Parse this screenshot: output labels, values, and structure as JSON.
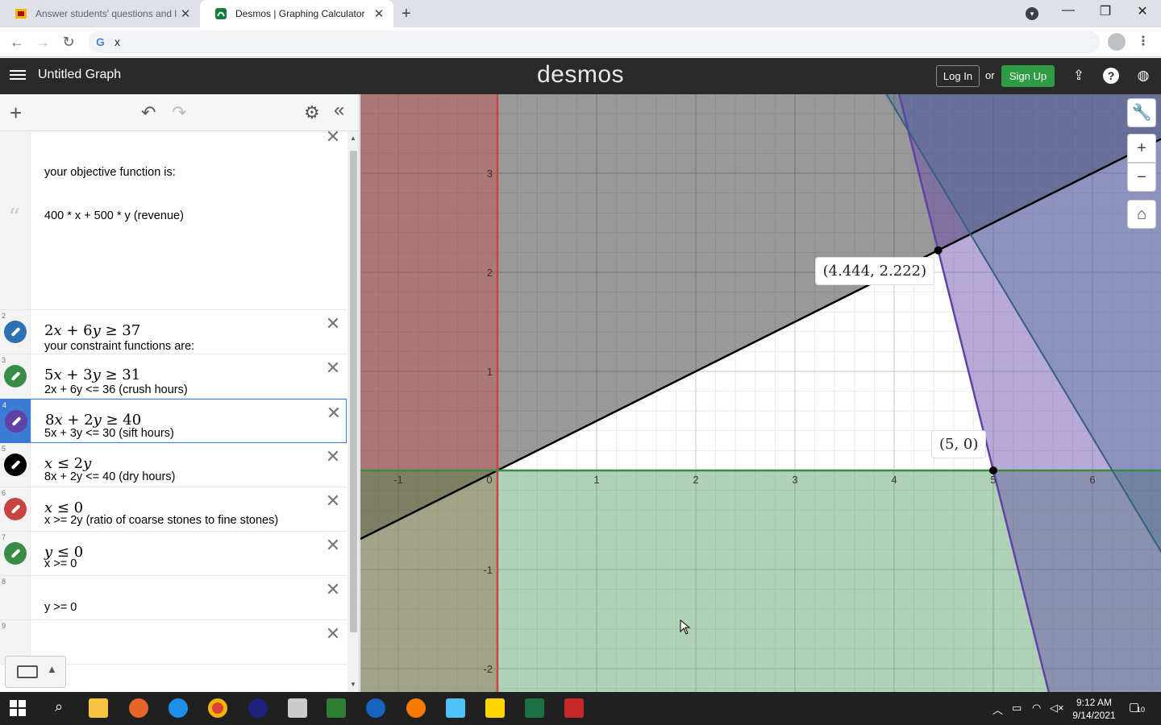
{
  "browser": {
    "tabs": [
      {
        "title": "Answer students' questions and l",
        "active": false
      },
      {
        "title": "Desmos | Graphing Calculator",
        "active": true
      }
    ],
    "address": "x",
    "new_tab": "+",
    "close_glyph": "✕"
  },
  "header": {
    "graph_title": "Untitled Graph",
    "logo": "desmos",
    "login": "Log In",
    "or": "or",
    "signup": "Sign Up"
  },
  "expressions": {
    "note_lines": [
      "your objective function is:",
      "400 * x + 500 * y (revenue)",
      "",
      "",
      "your constraint functions are:",
      "2x + 6y <= 36 (crush hours)",
      "5x + 3y <= 30 (sift hours)",
      "8x + 2y <= 40 (dry hours)",
      "x >= 2y (ratio of coarse stones to fine stones)",
      "x >= 0",
      "y >= 0"
    ],
    "items": [
      {
        "num": "2",
        "color": "#2d70b3",
        "parts": [
          "2",
          "x",
          " + 6",
          "y",
          " ≥ 37"
        ]
      },
      {
        "num": "3",
        "color": "#388c46",
        "parts": [
          "5",
          "x",
          " + 3",
          "y",
          " ≥  31"
        ]
      },
      {
        "num": "4",
        "color": "#6042a6",
        "parts": [
          "8",
          "x",
          " + 2",
          "y",
          " ≥  40"
        ]
      },
      {
        "num": "5",
        "color": "#000000",
        "parts": [
          "",
          "x",
          "  ≤  2",
          "y",
          ""
        ]
      },
      {
        "num": "6",
        "color": "#c74440",
        "parts": [
          "",
          "x",
          " ≤  0",
          "",
          ""
        ]
      },
      {
        "num": "7",
        "color": "#388c46",
        "parts": [
          "",
          "y",
          " ≤  0",
          "",
          ""
        ]
      },
      {
        "num": "8",
        "color": "",
        "parts": [
          "",
          "",
          "",
          "",
          ""
        ]
      },
      {
        "num": "9",
        "color": "",
        "parts": [
          "",
          "",
          "",
          "",
          ""
        ]
      }
    ]
  },
  "graph": {
    "x_ticks": [
      "-1",
      "0",
      "1",
      "2",
      "3",
      "4",
      "5",
      "6"
    ],
    "y_ticks": [
      "3",
      "2",
      "1",
      "-1",
      "-2"
    ],
    "points": [
      {
        "label": "(4.444, 2.222)",
        "x": 4.444,
        "y": 2.222
      },
      {
        "label": "(5, 0)",
        "x": 5,
        "y": 0
      }
    ],
    "colors": {
      "blue": "#2d70b3",
      "green": "#388c46",
      "purple": "#6042a6",
      "black": "#000000",
      "red": "#c74440"
    }
  },
  "taskbar": {
    "time": "9:12 AM",
    "date": "9/14/2021",
    "notifications": "10"
  }
}
